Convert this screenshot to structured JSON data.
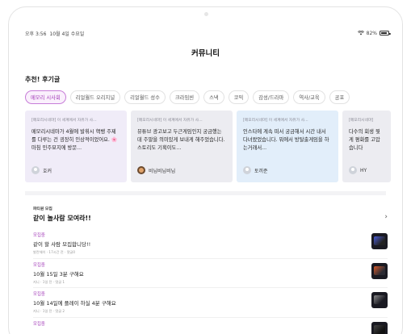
{
  "status_bar": {
    "time": "오후 3:56",
    "date": "10월 4일 수요일",
    "battery": "82%",
    "battery_level": 0.82
  },
  "header": {
    "title": "커뮤니티"
  },
  "recommended": {
    "title": "추천! 후기글",
    "chips": [
      {
        "label": "메모리 시사회",
        "active": true
      },
      {
        "label": "리얼월드 오리지널",
        "active": false
      },
      {
        "label": "리얼월드 성수",
        "active": false
      },
      {
        "label": "크라임씬",
        "active": false
      },
      {
        "label": "스낵",
        "active": false
      },
      {
        "label": "코믹",
        "active": false
      },
      {
        "label": "감성/드라마",
        "active": false
      },
      {
        "label": "역사/교육",
        "active": false
      },
      {
        "label": "공포",
        "active": false
      }
    ],
    "cards": [
      {
        "tag": "[메모리시네마] 이 세계에서 자유가 사...",
        "body": "메모리시네마가 4월에 발휘시 핵뱅 주제를 다루는 건 굉장히 인상적이었어요. 🌸 마침 민주묘지에 방문...",
        "user": "호커"
      },
      {
        "tag": "[메모리시네마] 이 세계에서 자유가 사...",
        "body": "뮤튜브 광고보고 두근게임인지 궁금했는데 주말을 의미있게 보내게 해주었습니다. 스토리도 기획이도...",
        "user": "비님비님비님"
      },
      {
        "tag": "[메모리시네마] 이 세계에서 자유가 사...",
        "body": "인스타에 계속 떠서 궁금해서 시간 내서 다녀왔었습니다. 뭐에서 방탈출게임을 하는거래서...",
        "user": "토끼준"
      },
      {
        "tag": "[메모리시네마]",
        "body": "다수의 회생 뭣게 평화를 고맙습니다",
        "user": "HY"
      }
    ]
  },
  "party": {
    "label": "파티원 모집",
    "title": "같이 놀사람 모여라!!",
    "posts": [
      {
        "status": "모집중",
        "title": "같이 할 사람 모집합니당!!",
        "meta": "발란체이 · 17시간 전 · 댓글0"
      },
      {
        "status": "모집중",
        "title": "10월 15일 3분 구해요",
        "meta": "지니 · 1일 전 · 댓글 1"
      },
      {
        "status": "모집중",
        "title": "10월 14일에 플레이 하실 4분 구해요",
        "meta": "지니 · 1일 전 · 댓글 2"
      },
      {
        "status": "모집중",
        "title": "",
        "meta": ""
      }
    ]
  },
  "colors": {
    "accent": "#a23bb8",
    "card_purple": "#f0ecf8",
    "card_gray": "#ececf1",
    "card_blue": "#e2eefa"
  },
  "icons": {
    "wifi": "wifi-icon",
    "battery": "battery-icon",
    "chevron": "chevron-right-icon"
  }
}
